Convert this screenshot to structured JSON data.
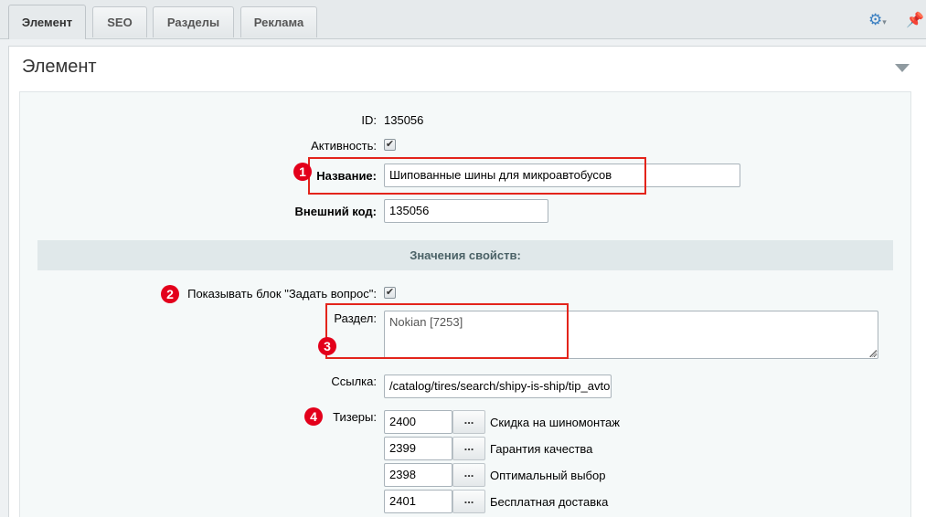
{
  "tabs": [
    {
      "label": "Элемент"
    },
    {
      "label": "SEO"
    },
    {
      "label": "Разделы"
    },
    {
      "label": "Реклама"
    }
  ],
  "panel": {
    "title": "Элемент"
  },
  "fields": {
    "id_label": "ID:",
    "id_value": "135056",
    "active_label": "Активность:",
    "active_checked": true,
    "name_label": "Название:",
    "name_value": "Шипованные шины для микроавтобусов",
    "ext_code_label": "Внешний код:",
    "ext_code_value": "135056"
  },
  "properties": {
    "section_title": "Значения свойств:",
    "show_question_label": "Показывать блок \"Задать вопрос\":",
    "show_question_checked": true,
    "section_label": "Раздел:",
    "section_value": "Nokian [7253]",
    "link_label": "Ссылка:",
    "link_value": "/catalog/tires/search/shipy-is-ship/tip_avto",
    "teasers_label": "Тизеры:",
    "teasers": [
      {
        "id": "2400",
        "button": "...",
        "name": "Скидка на шиномонтаж"
      },
      {
        "id": "2399",
        "button": "...",
        "name": "Гарантия качества"
      },
      {
        "id": "2398",
        "button": "...",
        "name": "Оптимальный выбор"
      },
      {
        "id": "2401",
        "button": "...",
        "name": "Бесплатная доставка"
      }
    ]
  },
  "markers": [
    "1",
    "2",
    "3",
    "4"
  ],
  "colors": {
    "accent": "#3a7fc1",
    "marker": "#e3001b",
    "section_bg": "#e0e8ea"
  },
  "icons": {
    "settings": "gear-icon",
    "pin": "pin-icon",
    "collapse": "collapse-arrow-icon",
    "check": "check-icon"
  }
}
